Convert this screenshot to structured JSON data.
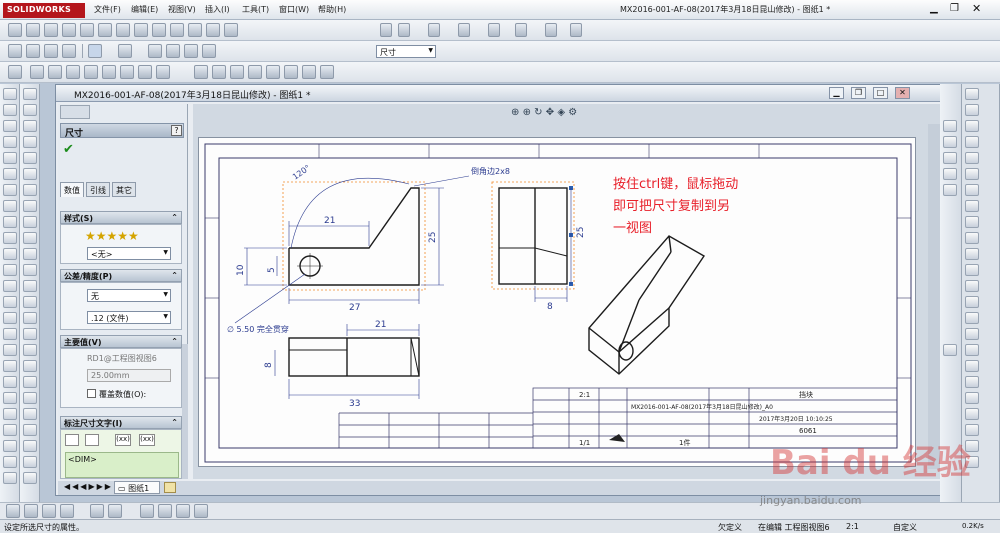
{
  "app": {
    "logo": "SOLIDWORKS",
    "window_title": "MX2016-001-AF-08(2017年3月18日昆山修改) - 图纸1 *"
  },
  "menu": [
    "文件(F)",
    "编辑(E)",
    "视图(V)",
    "插入(I)",
    "工具(T)",
    "窗口(W)",
    "帮助(H)"
  ],
  "toolbar": {
    "dim_combo": "尺寸"
  },
  "doc": {
    "title": "MX2016-001-AF-08(2017年3月18日昆山修改) - 图纸1 *"
  },
  "pm": {
    "title": "尺寸",
    "tabs": [
      "数值",
      "引线",
      "其它"
    ],
    "style": {
      "header": "样式(S)",
      "combo": "<无>"
    },
    "tolerance": {
      "header": "公差/精度(P)",
      "combo1": "无",
      "combo2": ".12 (文件)"
    },
    "primary": {
      "header": "主要值(V)",
      "ref": "RD1@工程图视图6",
      "value": "25.00mm",
      "override": "覆盖数值(O):"
    },
    "dimtext": {
      "header": "标注尺寸文字(I)",
      "token": "<DIM>",
      "btn1": "(xx)",
      "btn2": "(xx)"
    }
  },
  "drawing": {
    "angle": "120°",
    "chamfer": "倒角边2x8",
    "d21a": "21",
    "d25a": "25",
    "d10": "10",
    "d5": "5",
    "d27": "27",
    "hole": "∅ 5.50 完全贯穿",
    "d25b": "25",
    "d8a": "8",
    "d21b": "21",
    "d8b": "8",
    "d33": "33",
    "annotation_lines": [
      "按住ctrl键，鼠标拖动",
      "即可把尺寸复制到另",
      "一视图"
    ],
    "tb_scale": "2:1",
    "tb_name": "挡块",
    "tb_file": "MX2016-001-AF-08(2017年3月18日昆山修改)_A0",
    "tb_date": "2017年3月20日 10:10:25",
    "tb_mat": "6061",
    "tb_sheet": "1/1",
    "tb_qty": "1件"
  },
  "sheettab": "图纸1",
  "status": {
    "left": "设定所选尺寸的属性。",
    "undef": "欠定义",
    "editing": "在编辑 工程图视图6",
    "scale": "2:1",
    "right": "自定义",
    "net": "0.2K/s"
  },
  "watermark": {
    "brand": "Bai du 经验",
    "url": "jingyan.baidu.com"
  },
  "colors": {
    "annot_red": "#e8202a",
    "dim_blue": "#2b3b8f",
    "sw_red": "#b4161c"
  }
}
